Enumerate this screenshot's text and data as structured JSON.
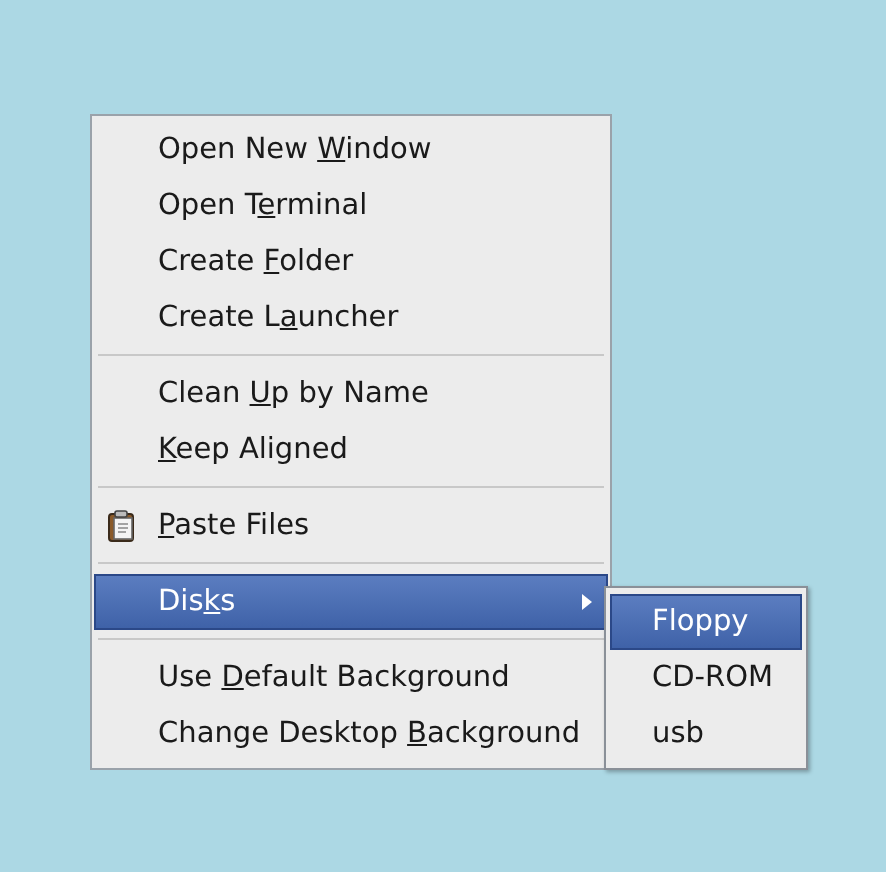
{
  "menu": {
    "groups": [
      {
        "items": [
          {
            "kind": "plain",
            "selected": false,
            "label": [
              {
                "text": "Open New ",
                "underlined": false
              },
              {
                "text": "W",
                "underlined": true
              },
              {
                "text": "indow",
                "underlined": false
              }
            ]
          },
          {
            "kind": "plain",
            "selected": false,
            "label": [
              {
                "text": "Open T",
                "underlined": false
              },
              {
                "text": "e",
                "underlined": true
              },
              {
                "text": "rminal",
                "underlined": false
              }
            ]
          },
          {
            "kind": "plain",
            "selected": false,
            "label": [
              {
                "text": "Create ",
                "underlined": false
              },
              {
                "text": "F",
                "underlined": true
              },
              {
                "text": "older",
                "underlined": false
              }
            ]
          },
          {
            "kind": "plain",
            "selected": false,
            "label": [
              {
                "text": "Create L",
                "underlined": false
              },
              {
                "text": "a",
                "underlined": true
              },
              {
                "text": "uncher",
                "underlined": false
              }
            ]
          }
        ]
      },
      {
        "items": [
          {
            "kind": "plain",
            "selected": false,
            "label": [
              {
                "text": "Clean ",
                "underlined": false
              },
              {
                "text": "U",
                "underlined": true
              },
              {
                "text": "p by Name",
                "underlined": false
              }
            ]
          },
          {
            "kind": "plain",
            "selected": false,
            "label": [
              {
                "text": "K",
                "underlined": true
              },
              {
                "text": "eep Aligned",
                "underlined": false
              }
            ]
          }
        ]
      },
      {
        "items": [
          {
            "kind": "with-icon",
            "selected": false,
            "label": [
              {
                "text": "P",
                "underlined": true
              },
              {
                "text": "aste Files",
                "underlined": false
              }
            ]
          }
        ]
      },
      {
        "items": [
          {
            "kind": "submenu",
            "selected": true,
            "label": [
              {
                "text": "Dis",
                "underlined": false
              },
              {
                "text": "k",
                "underlined": true
              },
              {
                "text": "s",
                "underlined": false
              }
            ],
            "submenu": {
              "items": [
                {
                  "label": "Floppy",
                  "selected": true
                },
                {
                  "label": "CD-ROM",
                  "selected": false
                },
                {
                  "label": "usb",
                  "selected": false
                }
              ]
            }
          }
        ]
      },
      {
        "items": [
          {
            "kind": "plain",
            "selected": false,
            "label": [
              {
                "text": "Use ",
                "underlined": false
              },
              {
                "text": "D",
                "underlined": true
              },
              {
                "text": "efault Background",
                "underlined": false
              }
            ]
          },
          {
            "kind": "plain",
            "selected": false,
            "label": [
              {
                "text": "Change Desktop ",
                "underlined": false
              },
              {
                "text": "B",
                "underlined": true
              },
              {
                "text": "ackground",
                "underlined": false
              }
            ]
          }
        ]
      }
    ]
  }
}
